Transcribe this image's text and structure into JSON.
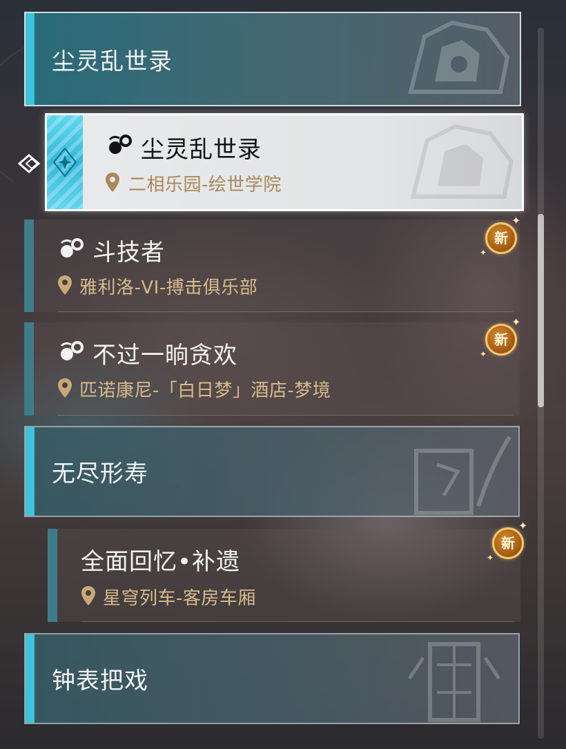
{
  "categories": [
    {
      "title": "尘灵乱世录"
    },
    {
      "title": "无尽形寿"
    },
    {
      "title": "钟表把戏"
    }
  ],
  "selected_quest": {
    "title": "尘灵乱世录",
    "location": "二相乐园-绘世学院"
  },
  "quests": [
    {
      "title": "斗技者",
      "location": "雅利洛-VI-搏击俱乐部",
      "badge": "新"
    },
    {
      "title": "不过一晌贪欢",
      "location": "匹诺康尼-「白日梦」酒店-梦境",
      "badge": "新"
    },
    {
      "title": "全面回忆•补遗",
      "location": "星穹列车-客房车厢",
      "badge": "新"
    }
  ],
  "colors": {
    "accent_cyan": "#3ec3dc",
    "quest_bar": "#3f7c8a",
    "location_gold": "#c9a877",
    "badge_orange": "#b86c1c"
  },
  "icons": {
    "quest": "companion-quest-icon",
    "location": "location-pin-icon",
    "selection": "diamond-selector-icon"
  }
}
